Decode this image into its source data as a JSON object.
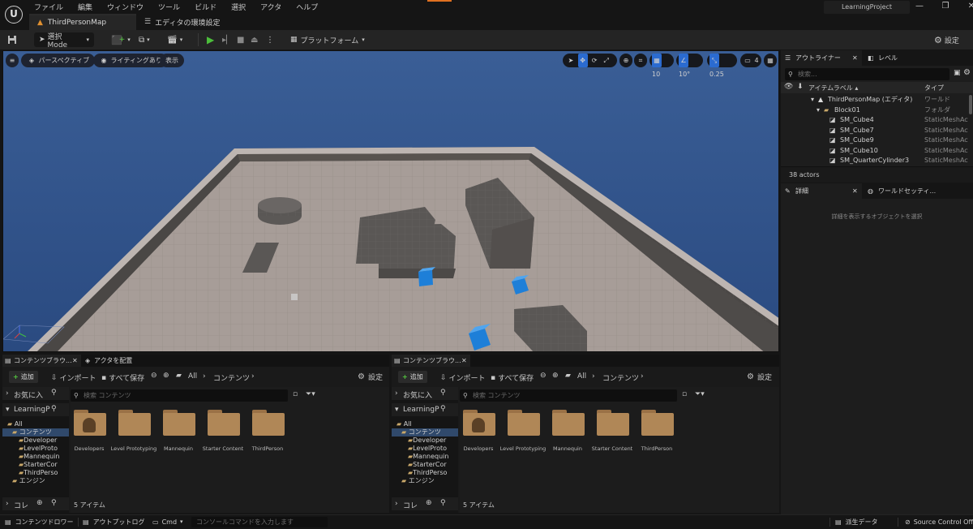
{
  "window": {
    "menu": [
      "ファイル",
      "編集",
      "ウィンドウ",
      "ツール",
      "ビルド",
      "選択",
      "アクタ",
      "ヘルプ"
    ],
    "map_tab": "ThirdPersonMap",
    "settings_tab": "エディタの環境設定",
    "project": "LearningProject",
    "controls": [
      "minimize-icon",
      "restore-icon",
      "close-icon"
    ]
  },
  "toolbar": {
    "mode": "選択 Mode",
    "platform": "プラットフォーム",
    "settings": "設定"
  },
  "viewport": {
    "hamburger": "≡",
    "perspective": "パースペクティブ",
    "lighting": "ライティングあり",
    "show": "表示",
    "grid_snap": "10",
    "rot_snap": "10°",
    "scale_snap": "0.25",
    "cam_speed": "4",
    "colors": {
      "sky_top": "#3a5d94",
      "sky_bottom": "#2c4f87",
      "floor": "#a79c97",
      "wall": "#4d4a48",
      "cube": "#1e7fd8"
    }
  },
  "outliner": {
    "tab": "アウトライナー",
    "tab2": "レベル",
    "search_placeholder": "検索...",
    "col_label": "アイテムラベル ▴",
    "col_type": "タイプ",
    "rows": [
      {
        "name": "ThirdPersonMap (エディタ)",
        "type": "ワールド"
      },
      {
        "name": "Block01",
        "type": "フォルダ"
      },
      {
        "name": "SM_Cube4",
        "type": "StaticMeshActor"
      },
      {
        "name": "SM_Cube7",
        "type": "StaticMeshActor"
      },
      {
        "name": "SM_Cube9",
        "type": "StaticMeshActor"
      },
      {
        "name": "SM_Cube10",
        "type": "StaticMeshActor"
      },
      {
        "name": "SM_QuarterCylinder3",
        "type": "StaticMeshActor"
      }
    ],
    "count": "38 actors"
  },
  "details": {
    "tab": "詳細",
    "tab2": "ワールドセッティ...",
    "empty": "詳細を表示するオブジェクトを選択"
  },
  "content_browser_1": {
    "tab": "コンテンツブラウ...",
    "tab2": "アクタを配置",
    "add": "追加",
    "import": "インポート",
    "save_all": "すべて保存",
    "path_all": "All",
    "path_content": "コンテンツ",
    "settings": "設定",
    "favorites": "お気に入",
    "project": "LearningP",
    "search_placeholder": "検索 コンテンツ",
    "tree": [
      "All",
      "コンテンツ",
      "Developer",
      "LevelProto",
      "Mannequin",
      "StarterCor",
      "ThirdPerso",
      "エンジン"
    ],
    "collections": "コレ",
    "items": [
      "Developers",
      "Level Prototyping",
      "Mannequin",
      "Starter Content",
      "ThirdPerson"
    ],
    "count": "5 アイテム"
  },
  "content_browser_2": {
    "tab": "コンテンツブラウ...",
    "add": "追加",
    "import": "インポート",
    "save_all": "すべて保存",
    "path_all": "All",
    "path_content": "コンテンツ",
    "settings": "設定",
    "favorites": "お気に入",
    "project": "LearningP",
    "search_placeholder": "検索 コンテンツ",
    "tree": [
      "All",
      "コンテンツ",
      "Developer",
      "LevelProto",
      "Mannequin",
      "StarterCor",
      "ThirdPerso",
      "エンジン"
    ],
    "collections": "コレ",
    "items": [
      "Developers",
      "Level Prototyping",
      "Mannequin",
      "Starter Content",
      "ThirdPerson"
    ],
    "count": "5 アイテム"
  },
  "statusbar": {
    "content_drawer": "コンテンツドロワー",
    "output_log": "アウトプットログ",
    "cmd": "Cmd",
    "console_placeholder": "コンソールコマンドを入力します",
    "derived_data": "派生データ",
    "source_control": "Source Control Off"
  }
}
